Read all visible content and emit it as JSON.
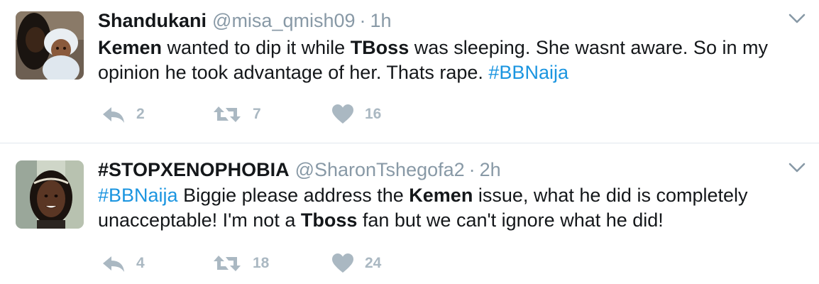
{
  "tweets": [
    {
      "display_name": "Shandukani",
      "handle": "@misa_qmish09",
      "separator": "·",
      "time": "1h",
      "text_segments": [
        {
          "text": "Kemen",
          "style": "bold"
        },
        {
          "text": " wanted to dip it while ",
          "style": "plain"
        },
        {
          "text": "TBoss",
          "style": "bold"
        },
        {
          "text": " was sleeping. She wasnt aware. So in my opinion he took advantage of her. Thats rape. ",
          "style": "plain"
        },
        {
          "text": "#BBNaija",
          "style": "hashtag"
        }
      ],
      "replies": "2",
      "retweets": "7",
      "likes": "16"
    },
    {
      "display_name": "#STOPXENOPHOBIA",
      "handle": "@SharonTshegofa2",
      "separator": "·",
      "time": "2h",
      "text_segments": [
        {
          "text": "#BBNaija",
          "style": "hashtag"
        },
        {
          "text": " Biggie please address the ",
          "style": "plain"
        },
        {
          "text": "Kemen",
          "style": "bold"
        },
        {
          "text": " issue, what he did is completely unacceptable! I'm not a ",
          "style": "plain"
        },
        {
          "text": "Tboss",
          "style": "bold"
        },
        {
          "text": " fan but we can't ignore what he did!",
          "style": "plain"
        }
      ],
      "replies": "4",
      "retweets": "18",
      "likes": "24"
    }
  ],
  "icons": {
    "reply": "reply-icon",
    "retweet": "retweet-icon",
    "like": "heart-icon",
    "menu": "chevron-down-icon"
  },
  "colors": {
    "text": "#14171a",
    "secondary": "#8899a6",
    "action_gray": "#aab8c2",
    "hashtag": "#1b95e0",
    "divider": "#e1e8ed"
  }
}
